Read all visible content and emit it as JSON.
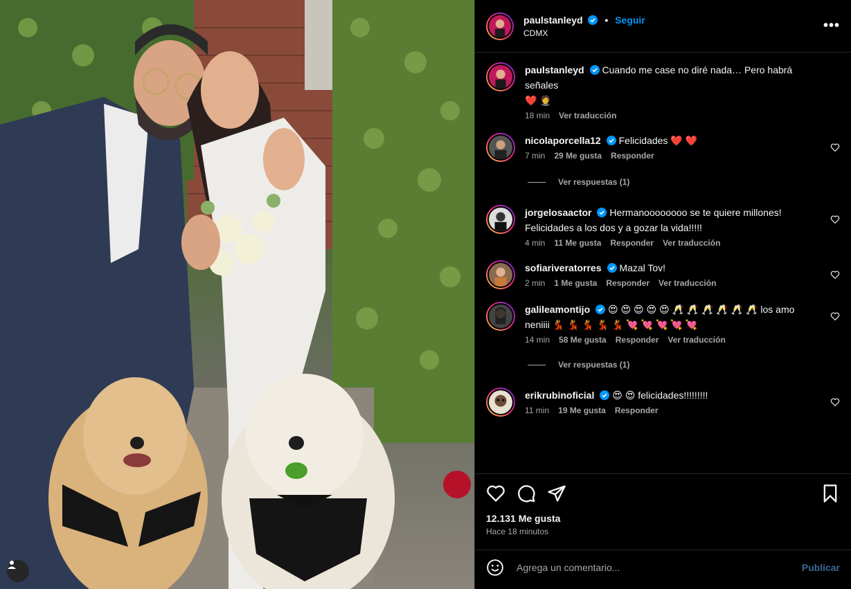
{
  "post": {
    "author": "paulstanleyd",
    "follow_label": "Seguir",
    "dot": "•",
    "location": "CDMX",
    "more_label": "•••",
    "caption": "Cuando me case no diré nada… Pero habrá señales",
    "caption_emoji": "❤️ 🤵",
    "caption_time": "18 min",
    "translate_label": "Ver traducción"
  },
  "comments": [
    {
      "user": "nicolaporcella12",
      "text": "Felicidades ❤️ ❤️",
      "time": "7 min",
      "likes": "29 Me gusta",
      "reply": "Responder",
      "translate": "",
      "replies": "Ver respuestas (1)"
    },
    {
      "user": "jorgelosaactor",
      "text": "Hermanoooooooo se te quiere millones! Felicidades a los dos y a gozar la vida!!!!!",
      "time": "4 min",
      "likes": "11 Me gusta",
      "reply": "Responder",
      "translate": "Ver traducción",
      "replies": ""
    },
    {
      "user": "sofiariveratorres",
      "text": "Mazal Tov!",
      "time": "2 min",
      "likes": "1 Me gusta",
      "reply": "Responder",
      "translate": "Ver traducción",
      "replies": ""
    },
    {
      "user": "galileamontijo",
      "text": "😍 😍 😍 😍 😍 🥂 🥂 🥂 🥂 🥂 🥂 los amo neniiii 💃 💃 💃 💃 💃 💘 💘 💘 💘 💘",
      "time": "14 min",
      "likes": "58 Me gusta",
      "reply": "Responder",
      "translate": "Ver traducción",
      "replies": "Ver respuestas (1)"
    },
    {
      "user": "erikrubinoficial",
      "text": "😍 😍 felicidades!!!!!!!!!",
      "time": "11 min",
      "likes": "19 Me gusta",
      "reply": "Responder",
      "translate": "",
      "replies": ""
    }
  ],
  "footer": {
    "likes": "12.131 Me gusta",
    "ago": "Hace 18 minutos",
    "comment_placeholder": "Agrega un comentario...",
    "publish_label": "Publicar"
  },
  "icons": {
    "like": "heart-icon",
    "comment": "comment-icon",
    "share": "share-icon",
    "save": "bookmark-icon",
    "emoji": "emoji-icon",
    "verified": "verified-badge-icon",
    "tag": "user-tag-icon"
  },
  "colors": {
    "background": "#000000",
    "verified": "#0095f6",
    "link": "#0095f6",
    "muted": "#a8a8a8",
    "border": "#262626"
  }
}
